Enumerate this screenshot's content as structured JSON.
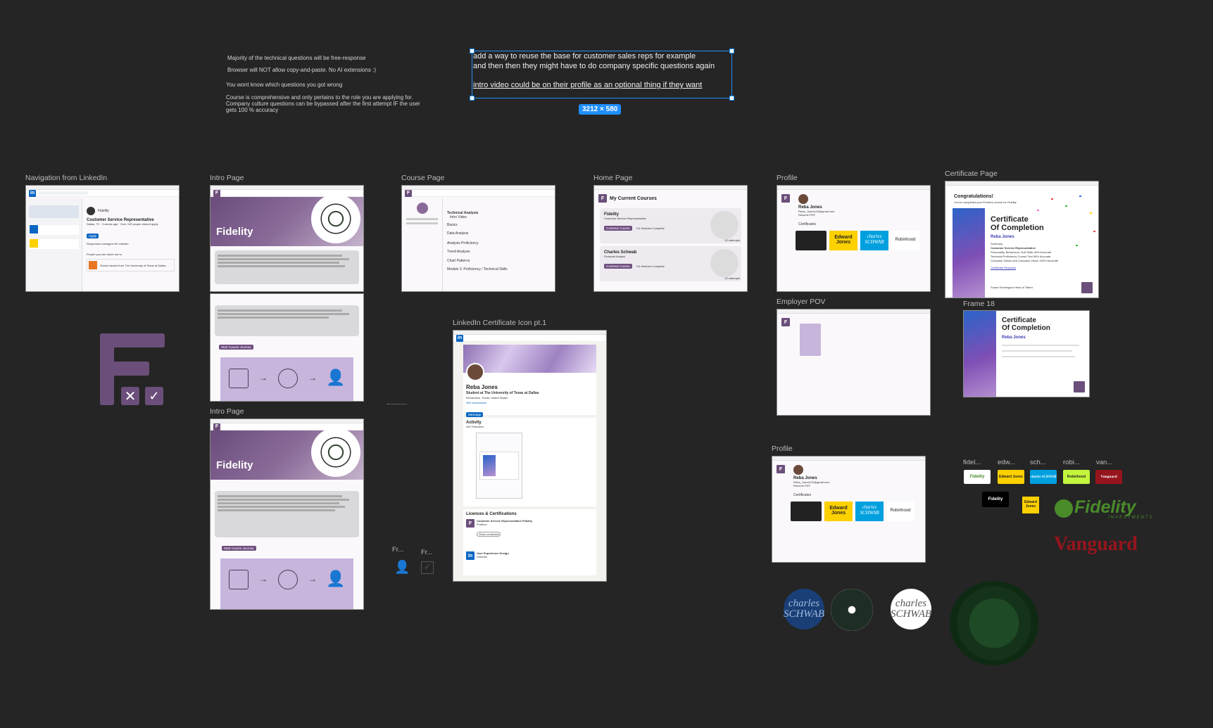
{
  "notes": [
    "Majority of the technical questions will be free-response",
    "Browser will NOT allow copy-and-paste. No AI extensions :)",
    "You wont know which questions you got wrong",
    "Course is comprehensive and only pertains to the role you are applying for.",
    "Company culture  questions can be bypassed after the first attempt IF the user",
    "gets 100 % accuracy"
  ],
  "selected_text": {
    "line1": "add a way to reuse the base for customer sales reps for example",
    "line2": "and then then they might have to do company specific questions again",
    "line3": "intro video could be on their profile as an optional thing if they want",
    "dimensions": "3212 × 580"
  },
  "frames": {
    "nav_linkedin": {
      "label": "Navigation from LinkedIn",
      "company": "Fidelity",
      "job_title": "Customer Service Representative",
      "meta": "Dallas, TX · 3 weeks ago · Over 100 people clicked apply",
      "managed": "Responses managed off LinkedIn",
      "reach": "People you can reach out to",
      "school": "School alumni from The University of Texas at Dallas"
    },
    "intro1": {
      "label": "Intro Page",
      "hero": "Fidelity",
      "button": "Start Course Journey"
    },
    "intro2": {
      "label": "Intro Page",
      "hero": "Fidelity",
      "button": "Start Course Journey"
    },
    "course": {
      "label": "Course Page",
      "items": [
        "Technical Analysis",
        "Intro Video",
        "Basics",
        "Data Analysis",
        "Analysis Proficiency",
        "Trend Analysis",
        "Chart Patterns",
        "Module 3: Proficiency / Technical Skills"
      ]
    },
    "home": {
      "label": "Home Page",
      "heading": "My Current Courses",
      "c1_name": "Fidelity",
      "c1_role": "Customer Service Representative",
      "c1_progress": "1/4 Modules Complete",
      "c1_attempts": "1/3 attempts",
      "c2_name": "Charles Schwab",
      "c2_role": "Financial Analyst",
      "c2_progress": "1/4 Modules Complete",
      "c2_attempts": "1/3 attempts",
      "button": "Continue Course"
    },
    "profile1": {
      "label": "Profile",
      "name": "Reba Jones",
      "email": "Reba_Jones123@gmail.com",
      "resume": "Resume PDF",
      "certs": "Certificates"
    },
    "profile2": {
      "label": "Profile",
      "name": "Reba Jones",
      "email": "Reba_Jones123@gmail.com",
      "resume": "Resume PDF",
      "certs": "Certificates"
    },
    "employer": {
      "label": "Employer POV"
    },
    "certificate": {
      "label": "Certificate Page",
      "congrats": "Congratulations!",
      "sub": "You've completed your Proflexo course for Fidelity",
      "title1": "Certificate",
      "title2": "Of Completion",
      "name": "Reba Jones",
      "summary": "Summary",
      "role": "Customer Service Representative",
      "lines": [
        "Personality, Behavioral, Soft Skills 96% Accurate",
        "Technical Proficiency Course Test 96% Accurate",
        "Company Values and Company Vision 100% Accurate"
      ],
      "link": "Certificate Requests",
      "signer": "Susan Dennington Head of Talent"
    },
    "frame18": {
      "label": "Frame 18",
      "title1": "Certificate",
      "title2": "Of Completion",
      "name": "Reba Jones"
    },
    "linkedin_cert": {
      "label": "LinkedIn Certificate Icon pt.1",
      "name": "Reba Jones",
      "headline": "Student at The University of Texas at Dallas",
      "location": "Richardson, Texas, United States",
      "contact": "Contact info",
      "connections": "405 connections",
      "activity": "Activity",
      "followers": "440 Followers",
      "licenses": "Licences & Certifications",
      "cert1": "Customer Service Representative Fidelity",
      "cert1_org": "Proflexo",
      "cert2": "User Experience Design",
      "cert2_org": "LinkedIn",
      "show": "Show credential"
    }
  },
  "small_frames": [
    "Fr...",
    "Fr..."
  ],
  "logo_labels": [
    "fidel...",
    "edw...",
    "sch...",
    "robi...",
    "van..."
  ],
  "logos": {
    "fidelity": "Fidelity",
    "edward": "Edward Jones",
    "charles": "charles SCHWAB",
    "robinhood": "Robinhood",
    "vanguard": "Vanguard",
    "fidelity_big": "Fidelity",
    "fidelity_sub": "INVESTMENTS",
    "vanguard_big": "Vanguard"
  },
  "colors": {
    "canvas": "#252525",
    "selection": "#1f8fff",
    "brand_purple": "#6b4f7a",
    "lilac": "#c7b5dc",
    "fidelity_green": "#4a8c2a",
    "vanguard_red": "#96151d",
    "schwab_blue": "#00a0df",
    "edward_yellow": "#fdd000",
    "robinhood_lime": "#c3f53c"
  }
}
